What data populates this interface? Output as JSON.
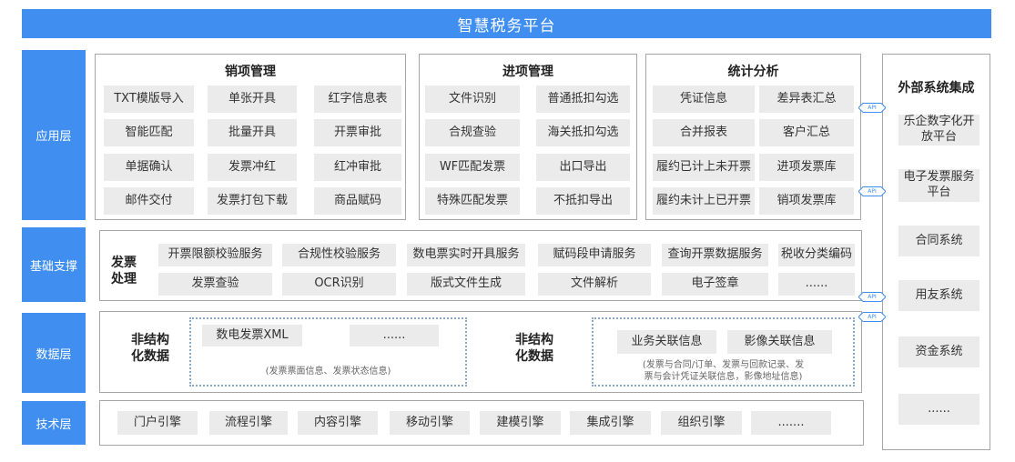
{
  "banner": "智慧税务平台",
  "layers": {
    "app": "应用层",
    "base": "基础支撑",
    "data": "数据层",
    "tech": "技术层"
  },
  "sales": {
    "title": "销项管理",
    "items": [
      "TXT模版导入",
      "单张开具",
      "红字信息表",
      "智能匹配",
      "批量开具",
      "开票审批",
      "单据确认",
      "发票冲红",
      "红冲审批",
      "邮件交付",
      "发票打包下载",
      "商品赋码"
    ]
  },
  "input": {
    "title": "进项管理",
    "items": [
      "文件识别",
      "普通抵扣勾选",
      "合规查验",
      "海关抵扣勾选",
      "WF匹配发票",
      "出口导出",
      "特殊匹配发票",
      "不抵扣导出"
    ]
  },
  "stats": {
    "title": "统计分析",
    "items": [
      "凭证信息",
      "差异表汇总",
      "合并报表",
      "客户汇总",
      "履约已计上未开票",
      "进项发票库",
      "履约未计上已开票",
      "销项发票库"
    ]
  },
  "base": {
    "label": "发票\n处理",
    "items": [
      "开票限额校验服务",
      "合规性校验服务",
      "数电票实时开具服务",
      "赋码段申请服务",
      "查询开票数据服务",
      "税收分类编码",
      "发票查验",
      "OCR识别",
      "版式文件生成",
      "文件解析",
      "电子签章",
      "......"
    ]
  },
  "data_layer": {
    "left_label": "非结构\n化数据",
    "left_items": [
      "数电发票XML",
      "......"
    ],
    "left_note": "(发票票面信息、发票状态信息)",
    "right_label": "非结构\n化数据",
    "right_items": [
      "业务关联信息",
      "影像关联信息"
    ],
    "right_note": "(发票与合同/订单、发票与回款记录、发\n票与会计凭证关联信息，影像地址信息)"
  },
  "tech": {
    "items": [
      "门户引擎",
      "流程引擎",
      "内容引擎",
      "移动引擎",
      "建模引擎",
      "集成引擎",
      "组织引擎",
      "......."
    ]
  },
  "external": {
    "title": "外部系统集成",
    "items": [
      "乐企数字化开\n放平台",
      "电子发票服务\n平台",
      "合同系统",
      "用友系统",
      "资金系统",
      "......"
    ]
  },
  "api_label": "API",
  "colors": {
    "accent": "#3f8ef0",
    "box": "#ebebeb",
    "border": "#a6a6a6"
  }
}
